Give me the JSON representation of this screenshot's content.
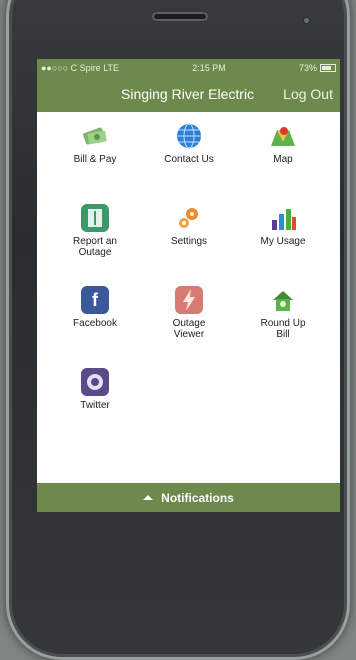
{
  "status": {
    "carrier": "●●○○○ C Spire  LTE",
    "time": "2:15 PM",
    "battery": "73%"
  },
  "header": {
    "title": "Singing River Electric",
    "logout_label": "Log Out"
  },
  "menu": [
    {
      "label": "Bill & Pay",
      "icon": "money-icon"
    },
    {
      "label": "Contact Us",
      "icon": "globe-icon"
    },
    {
      "label": "Map",
      "icon": "map-icon"
    },
    {
      "label": "Report an\nOutage",
      "icon": "report-icon"
    },
    {
      "label": "Settings",
      "icon": "gears-icon"
    },
    {
      "label": "My Usage",
      "icon": "bar-chart-icon"
    },
    {
      "label": "Facebook",
      "icon": "facebook-icon"
    },
    {
      "label": "Outage\nViewer",
      "icon": "lightning-icon"
    },
    {
      "label": "Round Up\nBill",
      "icon": "house-icon"
    },
    {
      "label": "Twitter",
      "icon": "twitter-icon"
    }
  ],
  "footer": {
    "notifications_label": "Notifications"
  },
  "colors": {
    "accent": "#6d8a4c"
  }
}
